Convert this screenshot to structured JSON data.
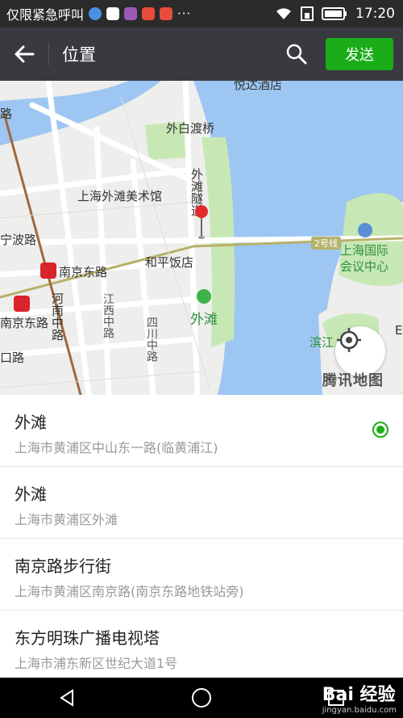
{
  "status_bar": {
    "carrier_text": "仅限紧急呼叫",
    "more": "···",
    "time": "17:20"
  },
  "header": {
    "title": "位置",
    "send_label": "发送"
  },
  "map": {
    "labels": {
      "yueda_hotel": "悦达酒店",
      "waibaidu_bridge": "外白渡桥",
      "bund_art_museum": "上海外滩美术馆",
      "bund_tunnel": "外滩隧道",
      "ningbo_road": "宁波路",
      "nanjing_east_road_1": "南京东路",
      "nanjing_east_road_2": "南京东路",
      "peace_hotel": "和平饭店",
      "henan_middle_road": "河南中路",
      "jiangxi_middle_road": "江西中路",
      "sichuan_middle_road": "四川中路",
      "the_bund": "外滩",
      "line2_badge": "2号线",
      "shanghai_intl_conv_center": "上海国际会议中心",
      "binjiang": "滨江",
      "left_road_1": "路",
      "left_road_2": "口路",
      "left_road_3": "E"
    },
    "watermark": "腾讯地图"
  },
  "places": [
    {
      "name": "外滩",
      "address": "上海市黄浦区中山东一路(临黄浦江)",
      "selected": true
    },
    {
      "name": "外滩",
      "address": "上海市黄浦区外滩",
      "selected": false
    },
    {
      "name": "南京路步行街",
      "address": "上海市黄浦区南京路(南京东路地铁站旁)",
      "selected": false
    },
    {
      "name": "东方明珠广播电视塔",
      "address": "上海市浦东新区世纪大道1号",
      "selected": false
    }
  ],
  "watermark": {
    "brand": "Bai 经验",
    "site": "jingyan.baidu.com"
  },
  "colors": {
    "accent": "#1aad19",
    "header_bg": "#393a3f",
    "water": "#9ec6f2",
    "park": "#c7e8b5"
  }
}
